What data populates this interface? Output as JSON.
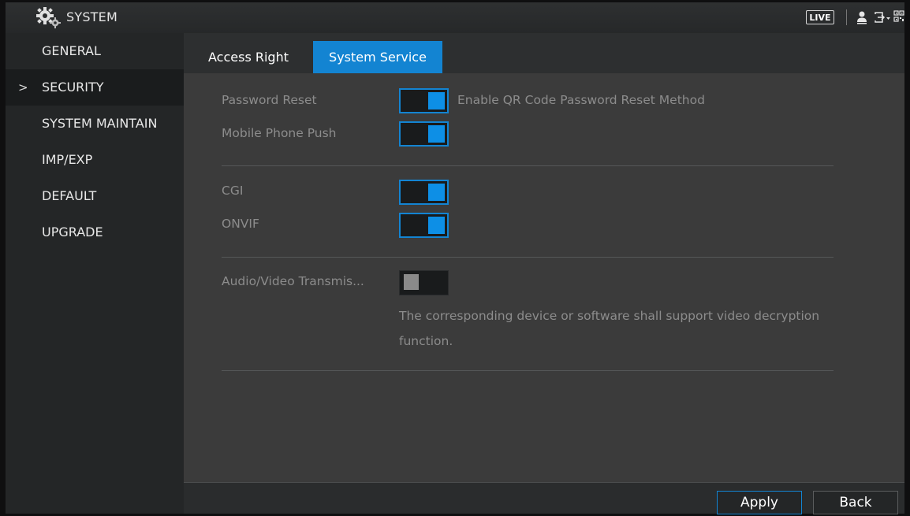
{
  "titlebar": {
    "title": "SYSTEM",
    "live_label": "LIVE",
    "icons": [
      "gears-icon",
      "user-icon",
      "logout-icon",
      "qr-code-icon"
    ]
  },
  "sidebar": {
    "items": [
      {
        "label": "GENERAL",
        "active": false
      },
      {
        "label": "SECURITY",
        "active": true
      },
      {
        "label": "SYSTEM MAINTAIN",
        "active": false
      },
      {
        "label": "IMP/EXP",
        "active": false
      },
      {
        "label": "DEFAULT",
        "active": false
      },
      {
        "label": "UPGRADE",
        "active": false
      }
    ],
    "active_marker": ">"
  },
  "tabs": [
    {
      "label": "Access Right",
      "selected": false
    },
    {
      "label": "System Service",
      "selected": true
    }
  ],
  "settings": {
    "password_reset": {
      "label": "Password Reset",
      "enabled": true,
      "description": "Enable QR Code Password Reset Method"
    },
    "mobile_phone_push": {
      "label": "Mobile Phone Push",
      "enabled": true
    },
    "cgi": {
      "label": "CGI",
      "enabled": true
    },
    "onvif": {
      "label": "ONVIF",
      "enabled": true
    },
    "av_transmission": {
      "label": "Audio/Video Transmis...",
      "enabled": false
    },
    "note_line1": "The corresponding device or software shall support video decryption",
    "note_line2": "function."
  },
  "footer": {
    "apply_label": "Apply",
    "back_label": "Back"
  },
  "colors": {
    "accent": "#1384d2",
    "toggle_knob_on": "#0d8fe6",
    "background": "#3b3b3b",
    "sidebar": "#242627"
  }
}
